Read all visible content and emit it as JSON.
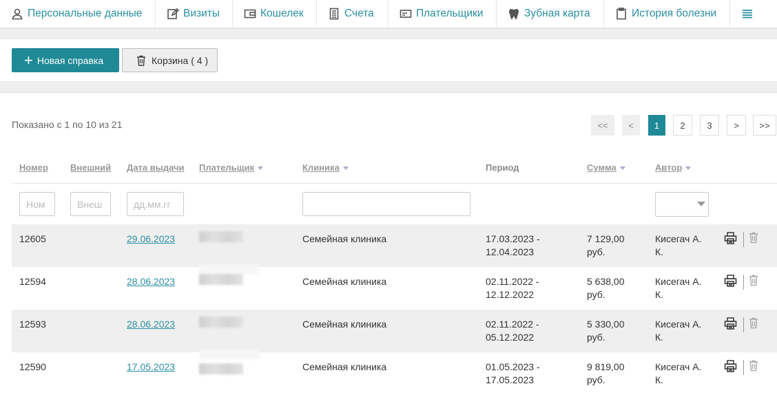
{
  "tabs": [
    {
      "label": "Персональные данные",
      "icon": "user-icon"
    },
    {
      "label": "Визиты",
      "icon": "edit-icon"
    },
    {
      "label": "Кошелек",
      "icon": "wallet-icon"
    },
    {
      "label": "Счета",
      "icon": "invoice-icon"
    },
    {
      "label": "Плательщики",
      "icon": "card-icon"
    },
    {
      "label": "Зубная карта",
      "icon": "tooth-icon"
    },
    {
      "label": "История болезни",
      "icon": "clipboard-icon"
    }
  ],
  "menu_icon": "hamburger-icon",
  "toolbar": {
    "new_label": "Новая справка",
    "trash_label": "Корзина ( 4 )"
  },
  "shown_text": "Показано с 1 по 10 из 21",
  "pager": [
    "<<",
    "<",
    "1",
    "2",
    "3",
    ">",
    ">>"
  ],
  "pager_active": "1",
  "columns": {
    "number": "Номер",
    "external": "Внешний",
    "date": "Дата выдачи",
    "payer": "Плательщик",
    "clinic": "Клиника",
    "period": "Период",
    "sum": "Сумма",
    "author": "Автор"
  },
  "filters": {
    "number_placeholder": "Ном",
    "external_placeholder": "Внеш",
    "date_placeholder": "дд.мм.гг"
  },
  "rows": [
    {
      "number": "12605",
      "date": "29.06.2023",
      "clinic": "Семейная клиника",
      "period_from": "17.03.2023 -",
      "period_to": "12.04.2023",
      "sum": "7 129,00",
      "currency": "руб.",
      "author1": "Кисегач А.",
      "author2": "К."
    },
    {
      "number": "12594",
      "date": "28.06.2023",
      "clinic": "Семейная клиника",
      "period_from": "02.11.2022 -",
      "period_to": "12.12.2022",
      "sum": "5 638,00",
      "currency": "руб.",
      "author1": "Кисегач А.",
      "author2": "К."
    },
    {
      "number": "12593",
      "date": "28.06.2023",
      "clinic": "Семейная клиника",
      "period_from": "02.11.2022 -",
      "period_to": "05.12.2022",
      "sum": "5 330,00",
      "currency": "руб.",
      "author1": "Кисегач А.",
      "author2": "К."
    },
    {
      "number": "12590",
      "date": "17.05.2023",
      "clinic": "Семейная клиника",
      "period_from": "01.05.2023 -",
      "period_to": "17.05.2023",
      "sum": "9 819,00",
      "currency": "руб.",
      "author1": "Кисегач А.",
      "author2": "К."
    }
  ]
}
